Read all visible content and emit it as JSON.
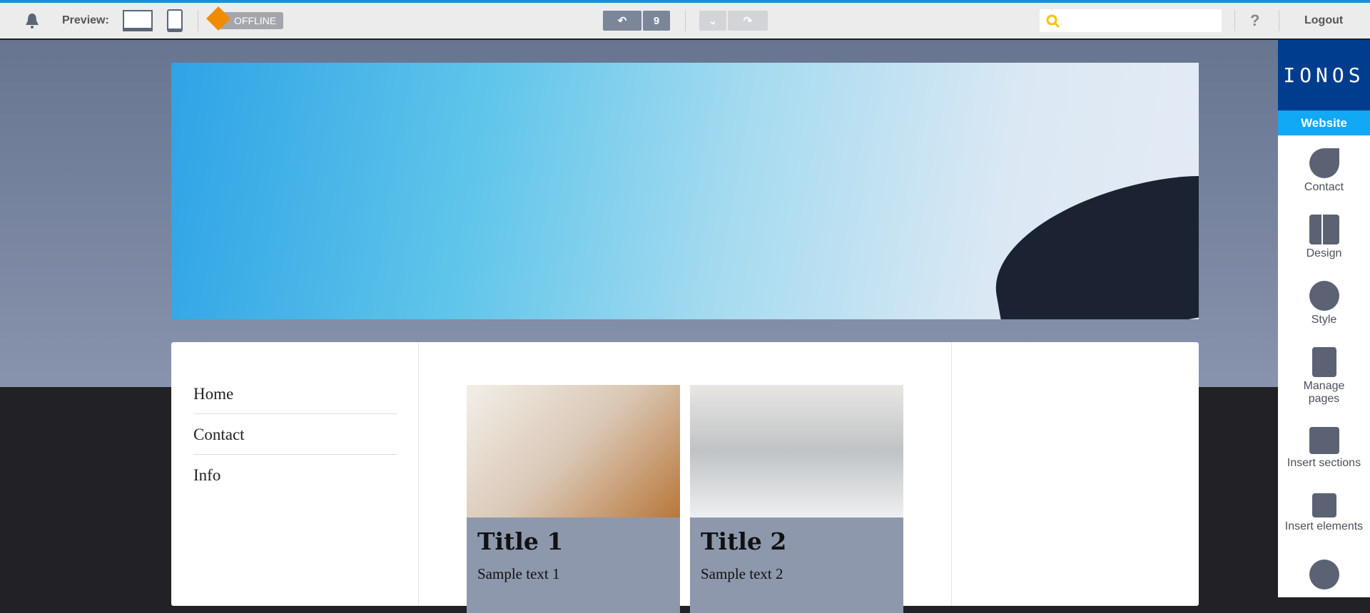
{
  "toolbar": {
    "preview_label": "Preview:",
    "offline_label": "OFFLINE",
    "undo_count": "9",
    "search_placeholder": "",
    "help_label": "?",
    "logout_label": "Logout"
  },
  "site": {
    "nav": [
      {
        "label": "Home"
      },
      {
        "label": "Contact"
      },
      {
        "label": "Info"
      }
    ],
    "tiles": [
      {
        "title": "Title 1",
        "text": "Sample text 1"
      },
      {
        "title": "Title 2",
        "text": "Sample text 2"
      }
    ]
  },
  "sidebar": {
    "logo": "IONOS",
    "section": "Website",
    "items": [
      {
        "label": "Contact",
        "icon": "phone-icon"
      },
      {
        "label": "Design",
        "icon": "layout-icon"
      },
      {
        "label": "Style",
        "icon": "palette-icon"
      },
      {
        "label": "Manage pages",
        "icon": "pages-icon"
      },
      {
        "label": "Insert sections",
        "icon": "sections-icon"
      },
      {
        "label": "Insert elements",
        "icon": "elements-icon"
      }
    ]
  },
  "colors": {
    "accent": "#1a8fdc",
    "brand": "#003d8f",
    "website_bar": "#11a8f5",
    "offline": "#f08c00"
  }
}
